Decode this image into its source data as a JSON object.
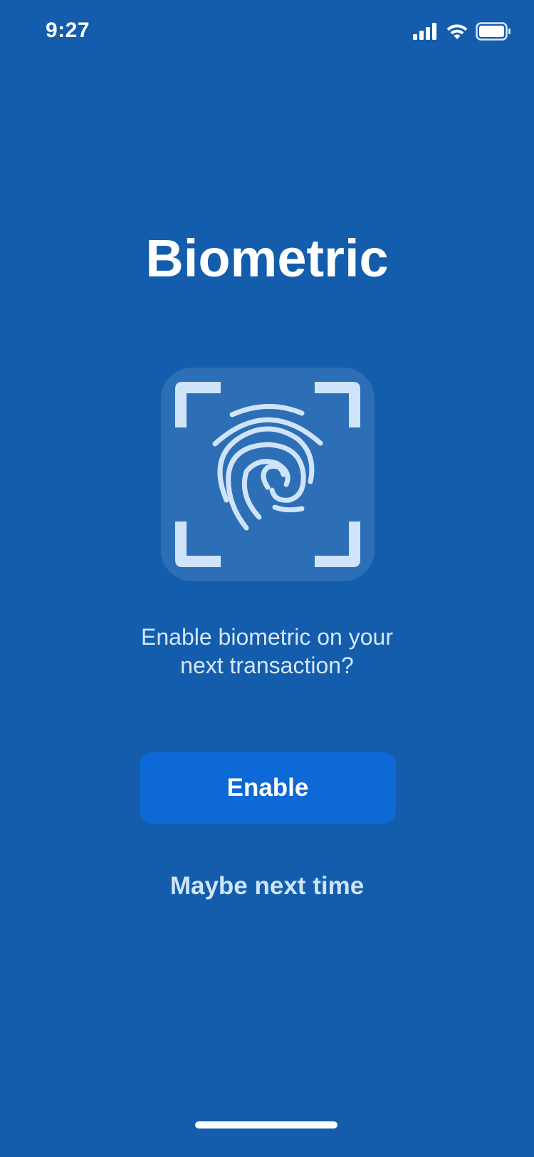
{
  "status_bar": {
    "time": "9:27",
    "signal_icon": "cellular-signal-icon",
    "wifi_icon": "wifi-icon",
    "battery_icon": "battery-icon"
  },
  "title": "Biometric",
  "fingerprint_icon": "fingerprint-icon",
  "prompt": {
    "line1": "Enable biometric on your",
    "line2": "next transaction?"
  },
  "actions": {
    "enable_label": "Enable",
    "later_label": "Maybe next time"
  },
  "colors": {
    "background": "#135DAC",
    "card": "#2D6FB6",
    "icon": "#CFE4FB",
    "primary_button": "#0D69D5",
    "secondary_text": "#CFE4FB"
  }
}
